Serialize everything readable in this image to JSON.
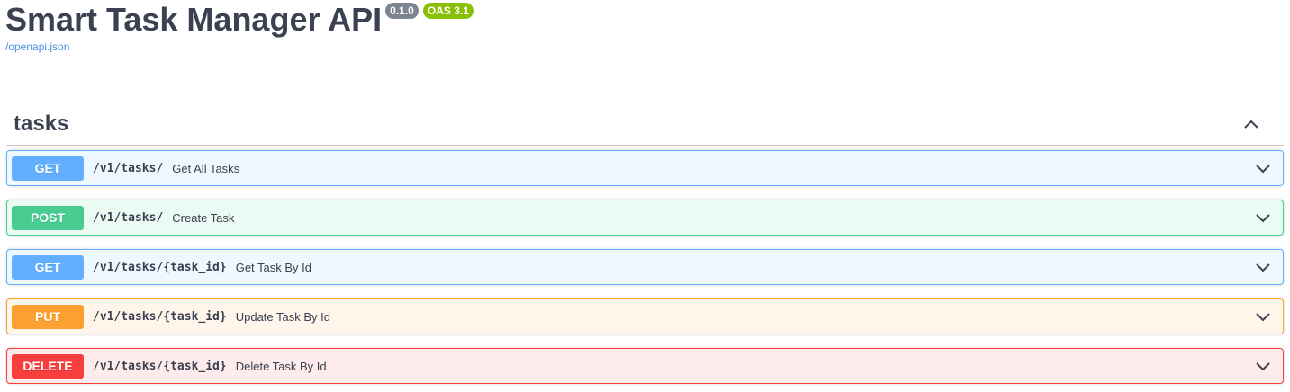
{
  "info": {
    "title": "Smart Task Manager API",
    "version_badge": "0.1.0",
    "oas_badge": "OAS 3.1",
    "spec_link": "/openapi.json"
  },
  "tag": {
    "name": "tasks",
    "toggle_icon": "chevron-up-icon"
  },
  "operations": [
    {
      "method": "GET",
      "path": "/v1/tasks/",
      "summary": "Get All Tasks",
      "color": "#61affe"
    },
    {
      "method": "POST",
      "path": "/v1/tasks/",
      "summary": "Create Task",
      "color": "#49cc90"
    },
    {
      "method": "GET",
      "path": "/v1/tasks/{task_id}",
      "summary": "Get Task By Id",
      "color": "#61affe"
    },
    {
      "method": "PUT",
      "path": "/v1/tasks/{task_id}",
      "summary": "Update Task By Id",
      "color": "#fca130"
    },
    {
      "method": "DELETE",
      "path": "/v1/tasks/{task_id}",
      "summary": "Delete Task By Id",
      "color": "#f93e3e"
    }
  ]
}
